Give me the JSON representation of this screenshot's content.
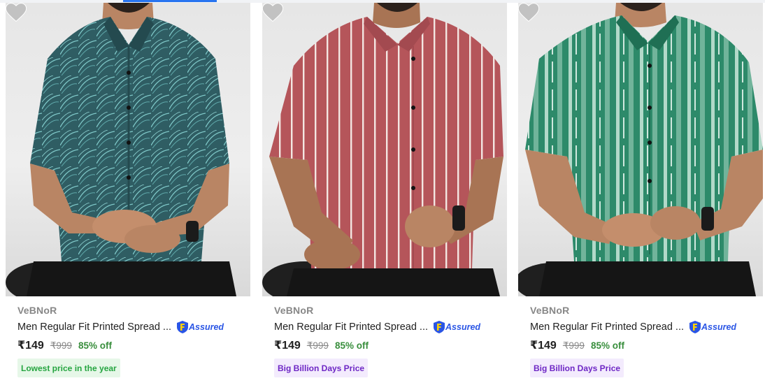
{
  "products": [
    {
      "brand": "VeBNoR",
      "title": "Men Regular Fit Printed Spread ...",
      "assured": "Assured",
      "price": "₹149",
      "mrp": "₹999",
      "discount": "85% off",
      "badge": "Lowest price in the year",
      "badge_color": "#26a541",
      "shirt_color": "#2f5d63",
      "pattern": "leaf print"
    },
    {
      "brand": "VeBNoR",
      "title": "Men Regular Fit Printed Spread ...",
      "assured": "Assured",
      "price": "₹149",
      "mrp": "₹999",
      "discount": "85% off",
      "badge": "Big Billion Days Price",
      "badge_color": "#6e27c5",
      "shirt_color": "#b5555a",
      "pattern": "white stripes"
    },
    {
      "brand": "VeBNoR",
      "title": "Men Regular Fit Printed Spread ...",
      "assured": "Assured",
      "price": "₹149",
      "mrp": "₹999",
      "discount": "85% off",
      "badge": "Big Billion Days Price",
      "badge_color": "#6e27c5",
      "shirt_color": "#2d8a6a",
      "pattern": "white brush stripes"
    }
  ],
  "icons": {
    "wishlist": "heart-icon",
    "assured": "flipkart-assured-badge-icon"
  },
  "colors": {
    "price_discount": "#388e3c",
    "assured_blue": "#2a55e5",
    "brand_grey": "#878787",
    "active_tab": "#2874f0"
  }
}
